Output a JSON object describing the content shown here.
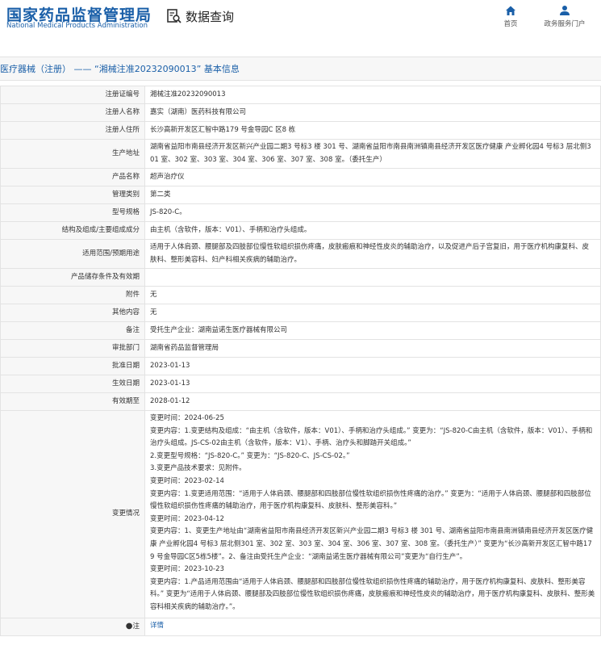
{
  "header": {
    "logo_cn": "国家药品监督管理局",
    "logo_en": "National Medical Products Administration",
    "search_label": "数据查询",
    "nav": [
      {
        "label": "首页",
        "icon": "home-icon"
      },
      {
        "label": "政务服务门户",
        "icon": "user-icon"
      }
    ]
  },
  "title": "医疗器械（注册） —— “湘械注准20232090013” 基本信息",
  "rows": [
    {
      "label": "注册证编号",
      "value": "湘械注准20232090013"
    },
    {
      "label": "注册人名称",
      "value": "嘉实（湖南）医药科技有限公司"
    },
    {
      "label": "注册人住所",
      "value": "长沙高新开发区汇智中路179 号金导园C 区8 栋"
    },
    {
      "label": "生产地址",
      "value": "湖南省益阳市南县经济开发区新兴产业园二期3 号标3 楼 301 号、湖南省益阳市南县南洲镇南县经济开发区医疗健康 产业孵化园4 号标3 层北侧301 室、302 室、303 室、304 室、306 室、307 室、308 室。（委托生产）"
    },
    {
      "label": "产品名称",
      "value": "超声治疗仪"
    },
    {
      "label": "管理类别",
      "value": "第二类"
    },
    {
      "label": "型号规格",
      "value": "JS-820-C。"
    },
    {
      "label": "结构及组成/主要组成成分",
      "value": "由主机（含软件，版本：V01）、手柄和治疗头组成。"
    },
    {
      "label": "适用范围/预期用途",
      "value": "适用于人体肩颈、腰腿部及四肢部位慢性软组织损伤疼痛，皮肤瘢痕和神经性皮炎的辅助治疗，以及促进产后子宫复旧，用于医疗机构康复科、皮肤科、整形美容科、妇产科相关疾病的辅助治疗。"
    },
    {
      "label": "产品储存条件及有效期",
      "value": ""
    },
    {
      "label": "附件",
      "value": "无"
    },
    {
      "label": "其他内容",
      "value": "无"
    },
    {
      "label": "备注",
      "value": "受托生产企业：湖南益诺生医疗器械有限公司"
    },
    {
      "label": "审批部门",
      "value": "湖南省药品监督管理局"
    },
    {
      "label": "批准日期",
      "value": "2023-01-13"
    },
    {
      "label": "生效日期",
      "value": "2023-01-13"
    },
    {
      "label": "有效期至",
      "value": "2028-01-12"
    }
  ],
  "changes": {
    "label": "变更情况",
    "lines": [
      "变更时间：2024-06-25",
      "变更内容：1.变更结构及组成：“由主机（含软件，版本：V01）、手柄和治疗头组成。” 变更为：“JS-820-C由主机（含软件，版本：V01）、手柄和治疗头组成。JS-CS-02由主机（含软件，版本：V1）、手柄、治疗头和脚踏开关组成。”",
      "2.变更型号规格：“JS-820-C。” 变更为：“JS-820-C、JS-CS-02。”",
      "3.变更产品技术要求：见附件。",
      "变更时间：2023-02-14",
      "变更内容：1.变更适用范围：“适用于人体肩颈、腰腿部和四肢部位慢性软组织损伤性疼痛的治疗。” 变更为：“适用于人体肩颈、腰腿部和四肢部位慢性软组织损伤性疼痛的辅助治疗，用于医疗机构康复科、皮肤科、整形美容科。”",
      "变更时间：2023-04-12",
      "变更内容：1、变更生产地址由“湖南省益阳市南县经济开发区新兴产业园二期3 号标3 楼 301 号、湖南省益阳市南县南洲镇南县经济开发区医疗健康 产业孵化园4 号标3 层北侧301 室、302 室、303 室、304 室、306 室、307 室、308 室。（委托生产）” 变更为“长沙高新开发区汇智中路179 号金导园C区5栋5楼”。2、备注由受托生产企业：“湖南益诺生医疗器械有限公司”变更为“自行生产”。",
      "变更时间：2023-10-23",
      "变更内容：1.产品适用范围由“适用于人体肩颈、腰腿部和四肢部位慢性软组织损伤性疼痛的辅助治疗，用于医疗机构康复科、皮肤科、整形美容科。” 变更为“适用于人体肩颈、腰腿部及四肢部位慢性软组织损伤疼痛，皮肤瘢痕和神经性皮炎的辅助治疗，用于医疗机构康复科、皮肤科、整形美容科相关疾病的辅助治疗。”。"
    ]
  },
  "note": {
    "label": "注",
    "link": "详情"
  }
}
